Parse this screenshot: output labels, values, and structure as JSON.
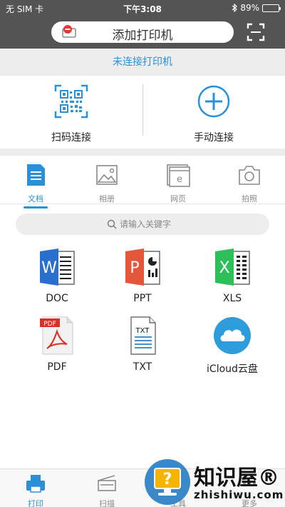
{
  "status": {
    "carrier": "无 SIM 卡",
    "time": "下午3:08",
    "battery": "89%"
  },
  "header": {
    "add_printer_label": "添加打印机",
    "icons": [
      "printer-remove-icon",
      "scan-frame-icon"
    ]
  },
  "connection": {
    "status_text": "未连接打印机",
    "scan_label": "扫码连接",
    "manual_label": "手动连接"
  },
  "tabs": [
    {
      "label": "文档",
      "icon": "document-icon",
      "active": true
    },
    {
      "label": "相册",
      "icon": "photo-icon",
      "active": false
    },
    {
      "label": "网页",
      "icon": "webpage-icon",
      "active": false
    },
    {
      "label": "拍照",
      "icon": "camera-icon",
      "active": false
    }
  ],
  "search": {
    "placeholder": "请输入关键字"
  },
  "file_types": [
    {
      "label": "DOC",
      "icon": "word-icon"
    },
    {
      "label": "PPT",
      "icon": "powerpoint-icon"
    },
    {
      "label": "XLS",
      "icon": "excel-icon"
    },
    {
      "label": "PDF",
      "icon": "pdf-icon"
    },
    {
      "label": "TXT",
      "icon": "txt-icon"
    },
    {
      "label": "iCloud云盘",
      "icon": "icloud-icon"
    }
  ],
  "bottom_nav": [
    {
      "label": "打印",
      "icon": "print-icon",
      "active": true
    },
    {
      "label": "扫描",
      "icon": "scanner-icon",
      "active": false
    },
    {
      "label": "工具",
      "icon": "tools-icon",
      "active": false
    },
    {
      "label": "更多",
      "icon": "more-icon",
      "active": false
    }
  ],
  "watermark": {
    "brand": "知识屋®",
    "domain": "zhishiwu.com"
  },
  "colors": {
    "accent": "#2a90d8",
    "header_bg": "#545454",
    "section_bg": "#ededed"
  }
}
